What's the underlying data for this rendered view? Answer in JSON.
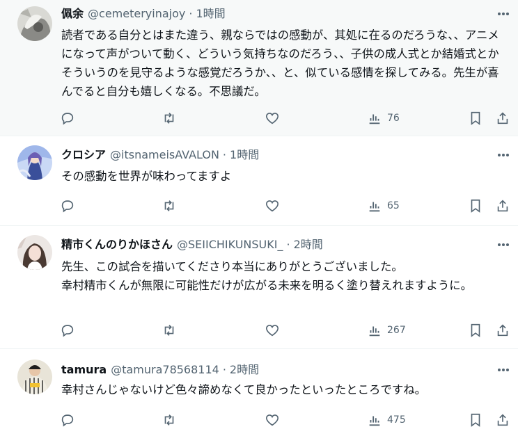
{
  "tweets": [
    {
      "name": "佩余",
      "handle": "@cemeteryinajoy",
      "time": "1時間",
      "text": "読者である自分とはまた違う、親ならではの感動が、其処に在るのだろうな、、アニメになって声がついて動く、どういう気持ちなのだろう、、子供の成人式とか結婚式とかそういうのを見守るような感覚だろうか、、と、似ている感情を探してみる。先生が喜んでると自分も嬉しくなる。不思議だ。",
      "views": "76"
    },
    {
      "name": "クロシア",
      "handle": "@itsnameisAVALON",
      "time": "1時間",
      "text": "その感動を世界が味わってますよ",
      "views": "65"
    },
    {
      "name": "精市くんのりかほさん",
      "handle": "@SEIICHIKUNSUKI_",
      "time": "2時間",
      "text": "先生、この試合を描いてくださり本当にありがとうございました。\n幸村精市くんが無限に可能性だけが広がる未来を明るく塗り替えれますように。",
      "views": "267"
    },
    {
      "name": "tamura",
      "handle": "@tamura78568114",
      "time": "2時間",
      "text": "幸村さんじゃないけど色々諦めなくて良かったといったところですね。",
      "views": "475"
    }
  ],
  "separator": "·",
  "icons": {
    "more": "more-dots-icon",
    "reply": "reply-bubble-icon",
    "retweet": "retweet-icon",
    "like": "heart-icon",
    "views": "bar-chart-icon",
    "bookmark": "bookmark-icon",
    "share": "share-upload-icon"
  },
  "colors": {
    "text": "#0f1419",
    "muted": "#536471",
    "divider": "#eff3f4",
    "highlight": "#f7f9f9"
  }
}
